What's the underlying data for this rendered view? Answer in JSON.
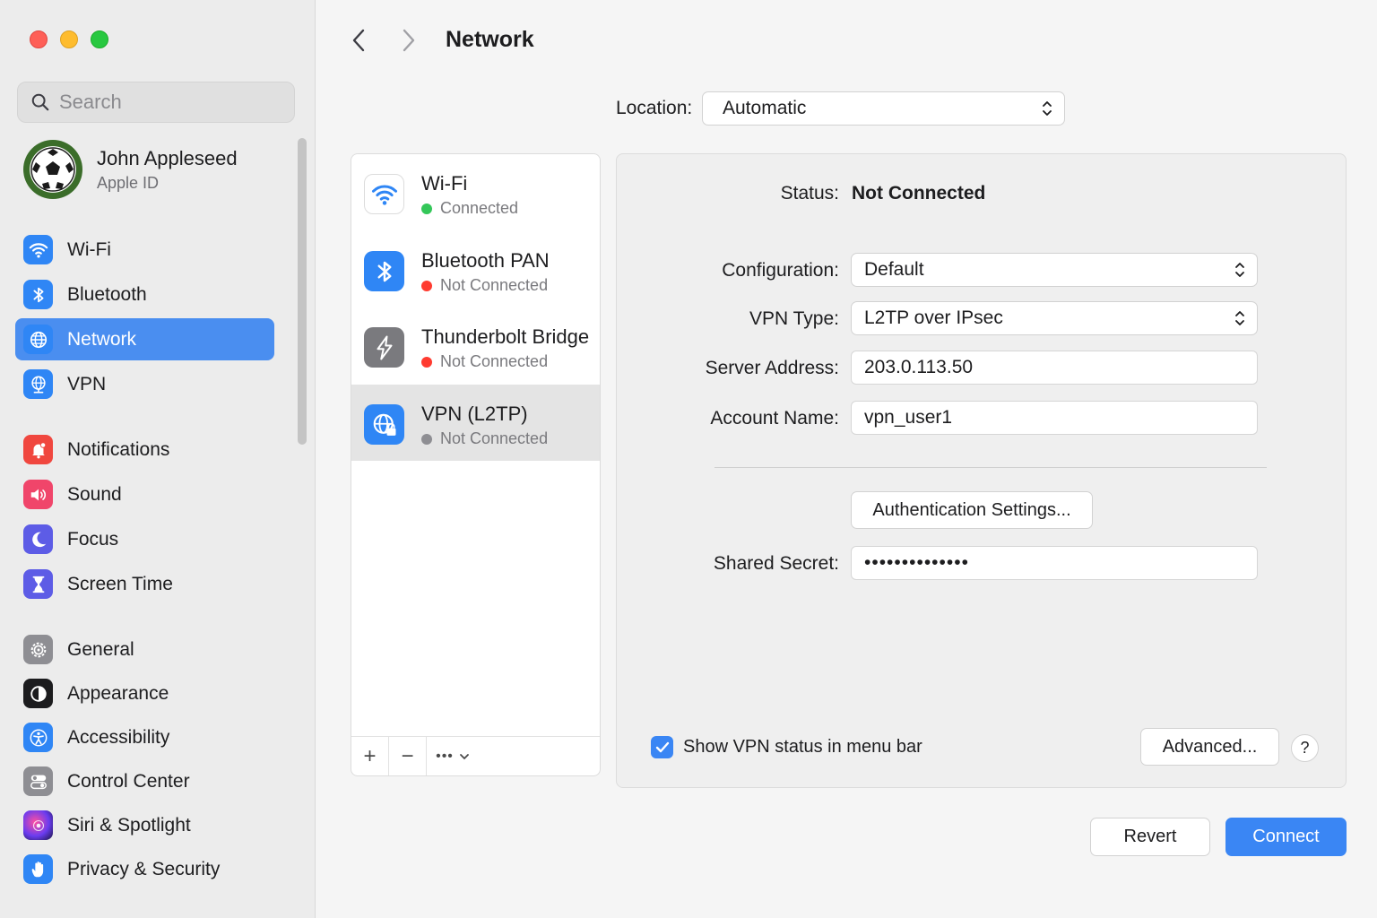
{
  "window": {
    "title": "Network"
  },
  "search": {
    "placeholder": "Search"
  },
  "account": {
    "name": "John Appleseed",
    "subtitle": "Apple ID"
  },
  "sidebar": {
    "items": [
      {
        "label": "Wi-Fi",
        "icon": "wifi-icon",
        "color": "#2f86f5"
      },
      {
        "label": "Bluetooth",
        "icon": "bluetooth-icon",
        "color": "#2f86f5"
      },
      {
        "label": "Network",
        "icon": "globe-icon",
        "color": "#2f86f5",
        "active": true
      },
      {
        "label": "VPN",
        "icon": "vpn-globe-icon",
        "color": "#2f86f5"
      },
      {
        "label": "Notifications",
        "icon": "bell-icon",
        "color": "#f0473f"
      },
      {
        "label": "Sound",
        "icon": "speaker-icon",
        "color": "#f0456a"
      },
      {
        "label": "Focus",
        "icon": "moon-icon",
        "color": "#5d5ce6"
      },
      {
        "label": "Screen Time",
        "icon": "hourglass-icon",
        "color": "#5d5ce6"
      },
      {
        "label": "General",
        "icon": "gear-icon",
        "color": "#8e8e93"
      },
      {
        "label": "Appearance",
        "icon": "appearance-icon",
        "color": "#1c1c1e"
      },
      {
        "label": "Accessibility",
        "icon": "accessibility-icon",
        "color": "#2f86f5"
      },
      {
        "label": "Control Center",
        "icon": "toggles-icon",
        "color": "#8e8e93"
      },
      {
        "label": "Siri & Spotlight",
        "icon": "siri-icon",
        "color": "#3b2a7a"
      },
      {
        "label": "Privacy & Security",
        "icon": "hand-icon",
        "color": "#2f86f5"
      }
    ]
  },
  "location": {
    "label": "Location:",
    "value": "Automatic"
  },
  "services": [
    {
      "name": "Wi-Fi",
      "status": "Connected",
      "status_color": "#34c759",
      "icon": "wifi-icon"
    },
    {
      "name": "Bluetooth PAN",
      "status": "Not Connected",
      "status_color": "#ff3b30",
      "icon": "bluetooth-icon"
    },
    {
      "name": "Thunderbolt Bridge",
      "status": "Not Connected",
      "status_color": "#ff3b30",
      "icon": "thunderbolt-icon"
    },
    {
      "name": "VPN (L2TP)",
      "status": "Not Connected",
      "status_color": "#8e8e93",
      "icon": "vpn-lock-icon",
      "selected": true
    }
  ],
  "service_toolbar": {
    "add": "+",
    "remove": "−",
    "more": "•••"
  },
  "detail": {
    "status_label": "Status:",
    "status_value": "Not Connected",
    "configuration_label": "Configuration:",
    "configuration_value": "Default",
    "vpn_type_label": "VPN Type:",
    "vpn_type_value": "L2TP over IPsec",
    "server_label": "Server Address:",
    "server_value": "203.0.113.50",
    "account_label": "Account Name:",
    "account_value": "vpn_user1",
    "auth_button": "Authentication Settings...",
    "secret_label": "Shared Secret:",
    "secret_value": "••••••••••••••",
    "show_status_label": "Show VPN status in menu bar",
    "show_status_checked": true,
    "advanced_button": "Advanced...",
    "help_button": "?"
  },
  "footer": {
    "revert": "Revert",
    "connect": "Connect"
  }
}
